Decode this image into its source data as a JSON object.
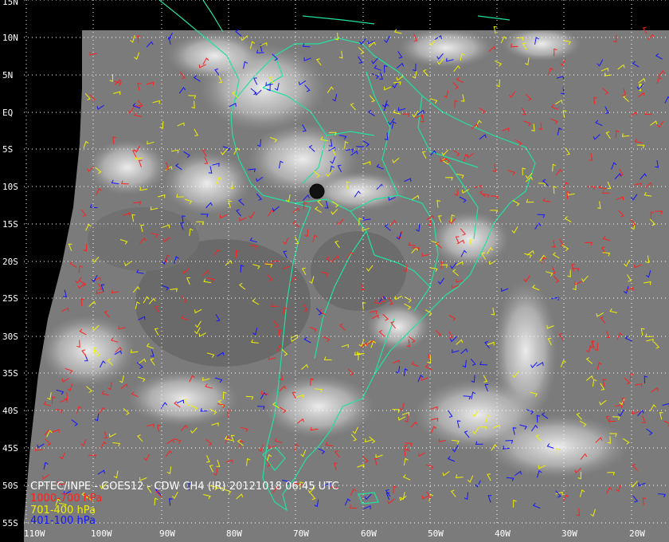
{
  "title": "CPTEC/INPE - GOES12 - CDW CH4 (IR) 20121018 06:45 UTC",
  "legend": [
    {
      "label": "1000-700 hPa",
      "color": "#ff2020"
    },
    {
      "label": "701-400 hPa",
      "color": "#f0f000"
    },
    {
      "label": "401-100 hPa",
      "color": "#1414ff"
    }
  ],
  "lat_labels": [
    "15N",
    "10N",
    "5N",
    "EQ",
    "5S",
    "10S",
    "15S",
    "20S",
    "25S",
    "30S",
    "35S",
    "40S",
    "45S",
    "50S",
    "55S"
  ],
  "lon_labels": [
    "110W",
    "100W",
    "90W",
    "80W",
    "70W",
    "60W",
    "50W",
    "40W",
    "30W",
    "20W"
  ],
  "colors": {
    "background": "#000000",
    "imagery": "#7a7a7a",
    "coastline": "#22e0a0",
    "grid": "#ffffff"
  }
}
